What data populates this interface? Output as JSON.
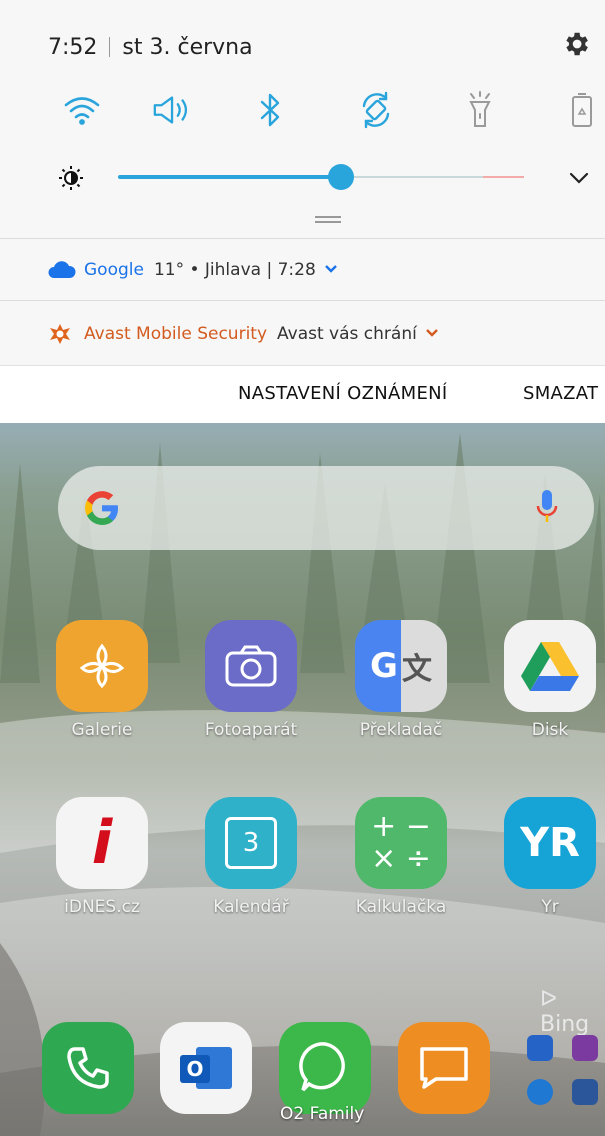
{
  "status": {
    "time": "7:52",
    "date": "st 3. června"
  },
  "quick_toggles": [
    "wifi-icon",
    "sound-icon",
    "bluetooth-icon",
    "auto-rotate-icon",
    "flashlight-icon",
    "power-saving-icon"
  ],
  "brightness": {
    "level": 0.55
  },
  "notifications": [
    {
      "app": "Google",
      "text": "11° • Jihlava  |  7:28",
      "icon": "cloud-icon"
    },
    {
      "app": "Avast Mobile Security",
      "text": "Avast vás chrání",
      "icon": "avast-icon"
    }
  ],
  "actions": {
    "settings": "NASTAVENÍ OZNÁMENÍ",
    "clear": "SMAZAT"
  },
  "home": {
    "apps": [
      "Galerie",
      "Fotoaparát",
      "Překladač",
      "Disk",
      "iDNES.cz",
      "Kalendář",
      "Kalkulačka",
      "Yr"
    ],
    "calendar_day": "3",
    "bing": "Bing",
    "carrier": "O2 Family"
  },
  "colors": {
    "accent": "#2aa5dc",
    "google_blue": "#1a73e8",
    "avast_orange": "#d35b1f"
  }
}
